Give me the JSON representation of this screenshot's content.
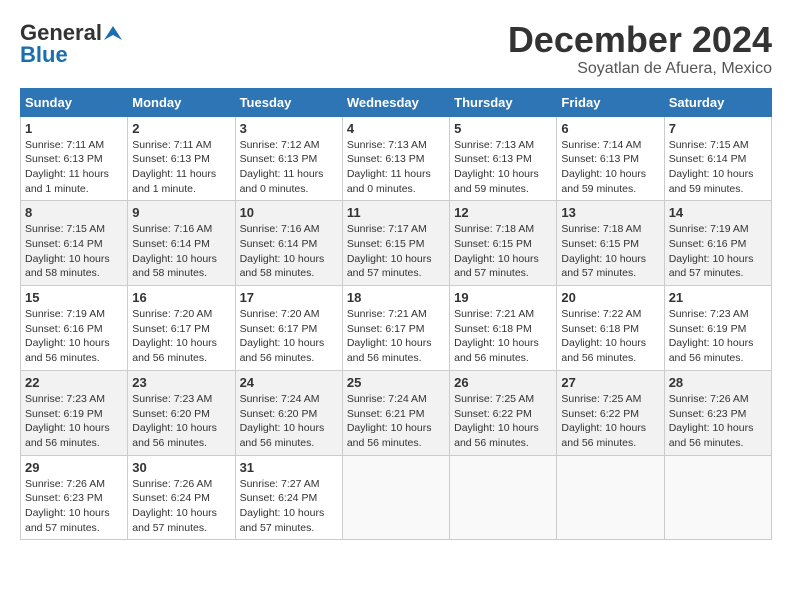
{
  "logo": {
    "line1": "General",
    "line2": "Blue"
  },
  "title": "December 2024",
  "location": "Soyatlan de Afuera, Mexico",
  "days_of_week": [
    "Sunday",
    "Monday",
    "Tuesday",
    "Wednesday",
    "Thursday",
    "Friday",
    "Saturday"
  ],
  "weeks": [
    [
      {
        "day": "1",
        "sunrise": "7:11 AM",
        "sunset": "6:13 PM",
        "daylight": "11 hours and 1 minute."
      },
      {
        "day": "2",
        "sunrise": "7:11 AM",
        "sunset": "6:13 PM",
        "daylight": "11 hours and 1 minute."
      },
      {
        "day": "3",
        "sunrise": "7:12 AM",
        "sunset": "6:13 PM",
        "daylight": "11 hours and 0 minutes."
      },
      {
        "day": "4",
        "sunrise": "7:13 AM",
        "sunset": "6:13 PM",
        "daylight": "11 hours and 0 minutes."
      },
      {
        "day": "5",
        "sunrise": "7:13 AM",
        "sunset": "6:13 PM",
        "daylight": "10 hours and 59 minutes."
      },
      {
        "day": "6",
        "sunrise": "7:14 AM",
        "sunset": "6:13 PM",
        "daylight": "10 hours and 59 minutes."
      },
      {
        "day": "7",
        "sunrise": "7:15 AM",
        "sunset": "6:14 PM",
        "daylight": "10 hours and 59 minutes."
      }
    ],
    [
      {
        "day": "8",
        "sunrise": "7:15 AM",
        "sunset": "6:14 PM",
        "daylight": "10 hours and 58 minutes."
      },
      {
        "day": "9",
        "sunrise": "7:16 AM",
        "sunset": "6:14 PM",
        "daylight": "10 hours and 58 minutes."
      },
      {
        "day": "10",
        "sunrise": "7:16 AM",
        "sunset": "6:14 PM",
        "daylight": "10 hours and 58 minutes."
      },
      {
        "day": "11",
        "sunrise": "7:17 AM",
        "sunset": "6:15 PM",
        "daylight": "10 hours and 57 minutes."
      },
      {
        "day": "12",
        "sunrise": "7:18 AM",
        "sunset": "6:15 PM",
        "daylight": "10 hours and 57 minutes."
      },
      {
        "day": "13",
        "sunrise": "7:18 AM",
        "sunset": "6:15 PM",
        "daylight": "10 hours and 57 minutes."
      },
      {
        "day": "14",
        "sunrise": "7:19 AM",
        "sunset": "6:16 PM",
        "daylight": "10 hours and 57 minutes."
      }
    ],
    [
      {
        "day": "15",
        "sunrise": "7:19 AM",
        "sunset": "6:16 PM",
        "daylight": "10 hours and 56 minutes."
      },
      {
        "day": "16",
        "sunrise": "7:20 AM",
        "sunset": "6:17 PM",
        "daylight": "10 hours and 56 minutes."
      },
      {
        "day": "17",
        "sunrise": "7:20 AM",
        "sunset": "6:17 PM",
        "daylight": "10 hours and 56 minutes."
      },
      {
        "day": "18",
        "sunrise": "7:21 AM",
        "sunset": "6:17 PM",
        "daylight": "10 hours and 56 minutes."
      },
      {
        "day": "19",
        "sunrise": "7:21 AM",
        "sunset": "6:18 PM",
        "daylight": "10 hours and 56 minutes."
      },
      {
        "day": "20",
        "sunrise": "7:22 AM",
        "sunset": "6:18 PM",
        "daylight": "10 hours and 56 minutes."
      },
      {
        "day": "21",
        "sunrise": "7:23 AM",
        "sunset": "6:19 PM",
        "daylight": "10 hours and 56 minutes."
      }
    ],
    [
      {
        "day": "22",
        "sunrise": "7:23 AM",
        "sunset": "6:19 PM",
        "daylight": "10 hours and 56 minutes."
      },
      {
        "day": "23",
        "sunrise": "7:23 AM",
        "sunset": "6:20 PM",
        "daylight": "10 hours and 56 minutes."
      },
      {
        "day": "24",
        "sunrise": "7:24 AM",
        "sunset": "6:20 PM",
        "daylight": "10 hours and 56 minutes."
      },
      {
        "day": "25",
        "sunrise": "7:24 AM",
        "sunset": "6:21 PM",
        "daylight": "10 hours and 56 minutes."
      },
      {
        "day": "26",
        "sunrise": "7:25 AM",
        "sunset": "6:22 PM",
        "daylight": "10 hours and 56 minutes."
      },
      {
        "day": "27",
        "sunrise": "7:25 AM",
        "sunset": "6:22 PM",
        "daylight": "10 hours and 56 minutes."
      },
      {
        "day": "28",
        "sunrise": "7:26 AM",
        "sunset": "6:23 PM",
        "daylight": "10 hours and 56 minutes."
      }
    ],
    [
      {
        "day": "29",
        "sunrise": "7:26 AM",
        "sunset": "6:23 PM",
        "daylight": "10 hours and 57 minutes."
      },
      {
        "day": "30",
        "sunrise": "7:26 AM",
        "sunset": "6:24 PM",
        "daylight": "10 hours and 57 minutes."
      },
      {
        "day": "31",
        "sunrise": "7:27 AM",
        "sunset": "6:24 PM",
        "daylight": "10 hours and 57 minutes."
      },
      null,
      null,
      null,
      null
    ]
  ]
}
